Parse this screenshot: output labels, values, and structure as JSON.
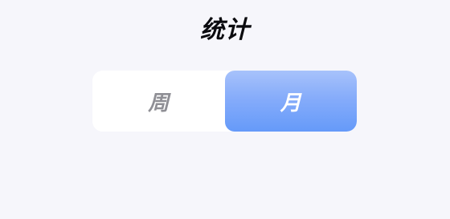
{
  "header": {
    "title": "统计"
  },
  "period_toggle": {
    "options": [
      {
        "label": "周",
        "selected": false
      },
      {
        "label": "月",
        "selected": true
      }
    ]
  },
  "colors": {
    "background": "#f6f6fb",
    "active_gradient_top": "#a7c2fb",
    "active_gradient_bottom": "#659af9",
    "inactive_text": "#8f8f95"
  }
}
